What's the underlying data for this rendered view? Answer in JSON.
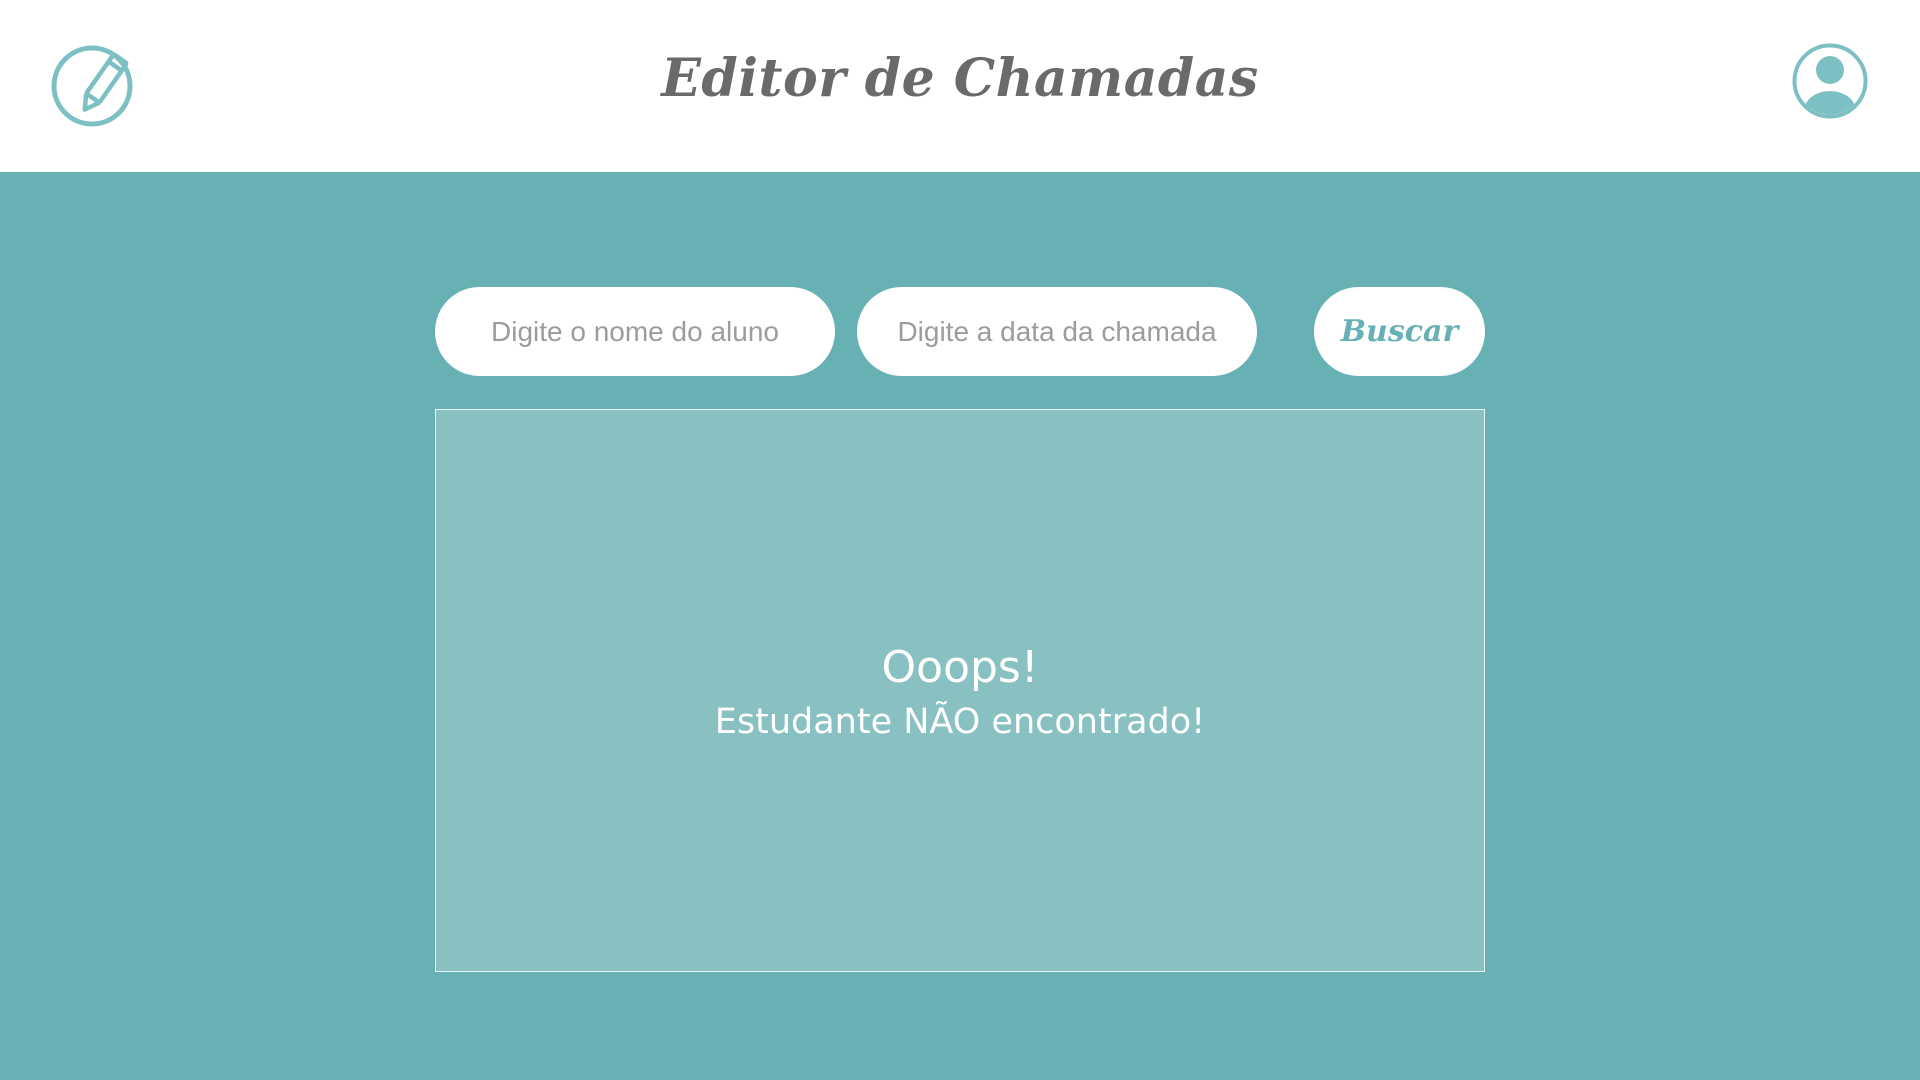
{
  "header": {
    "title": "Editor de Chamadas",
    "left_icon": "edit-pencil-icon",
    "right_icon": "user-profile-icon"
  },
  "search": {
    "name_placeholder": "Digite o nome do aluno",
    "date_placeholder": "Digite a data da chamada",
    "button_label": "Buscar"
  },
  "results": {
    "message_title": "Ooops!",
    "message_subtitle": "Estudante NÃO encontrado!"
  },
  "colors": {
    "background": "#67b0b4",
    "panel": "#89c0c2",
    "header": "#ffffff",
    "title_text": "#6a6a6a",
    "accent": "#7cc0c4"
  }
}
